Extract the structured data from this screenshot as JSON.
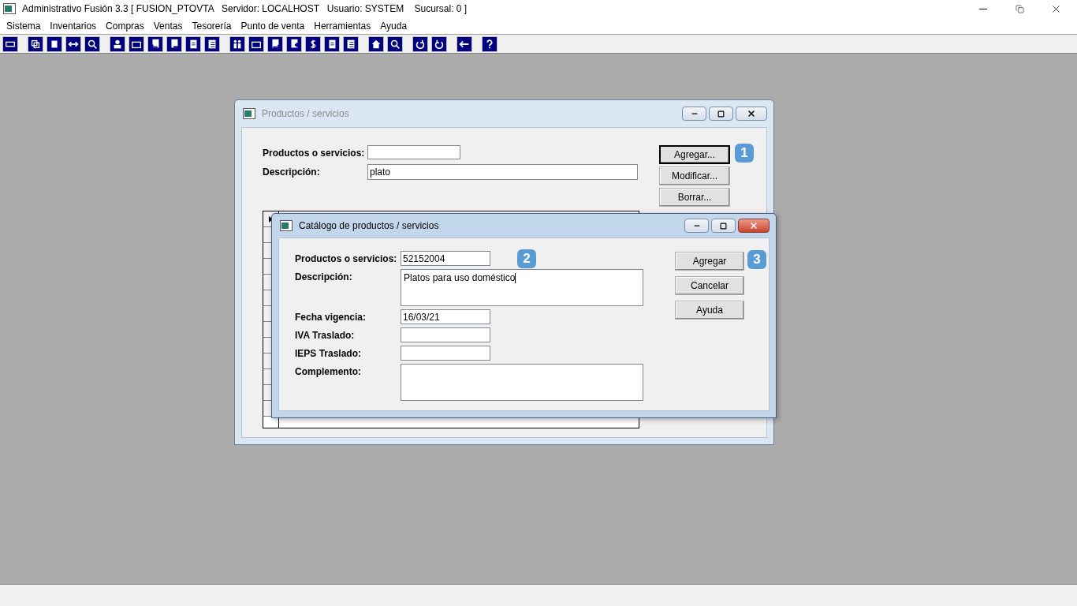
{
  "window": {
    "title": "Administrativo Fusión 3.3 [ FUSION_PTOVTA   Servidor: LOCALHOST   Usuario: SYSTEM    Sucursal: 0 ]"
  },
  "menu": [
    "Sistema",
    "Inventarios",
    "Compras",
    "Ventas",
    "Tesorería",
    "Punto de venta",
    "Herramientas",
    "Ayuda"
  ],
  "products_window": {
    "title": "Productos / servicios",
    "active": false,
    "fields": [
      {
        "label": "Productos o servicios:"
      },
      {
        "label": "Descripción:",
        "value": "plato"
      }
    ],
    "buttons": [
      {
        "label": "Agregar...",
        "default": true
      },
      {
        "label": "Modificar...",
        "default": false
      },
      {
        "label": "Borrar...",
        "default": false
      }
    ],
    "badge": "1"
  },
  "catalog_dialog": {
    "title": "Catálogo de productos / servicios",
    "active": true,
    "fields": [
      {
        "label": "Productos o servicios:",
        "value": "52152004",
        "kind": "short"
      },
      {
        "label": "Descripción:",
        "value": "Platos para uso doméstico",
        "kind": "multiline",
        "focused": true
      },
      {
        "label": "Fecha vigencia:",
        "value": "16/03/21",
        "kind": "short"
      },
      {
        "label": "IVA Traslado:",
        "kind": "short"
      },
      {
        "label": "IEPS Traslado:",
        "kind": "short"
      },
      {
        "label": "Complemento:",
        "kind": "multiline",
        "focused": false
      }
    ],
    "buttons": [
      {
        "label": "Agregar",
        "badge": "3"
      },
      {
        "label": "Cancelar"
      },
      {
        "label": "Ayuda"
      }
    ],
    "field_badge": "2"
  }
}
